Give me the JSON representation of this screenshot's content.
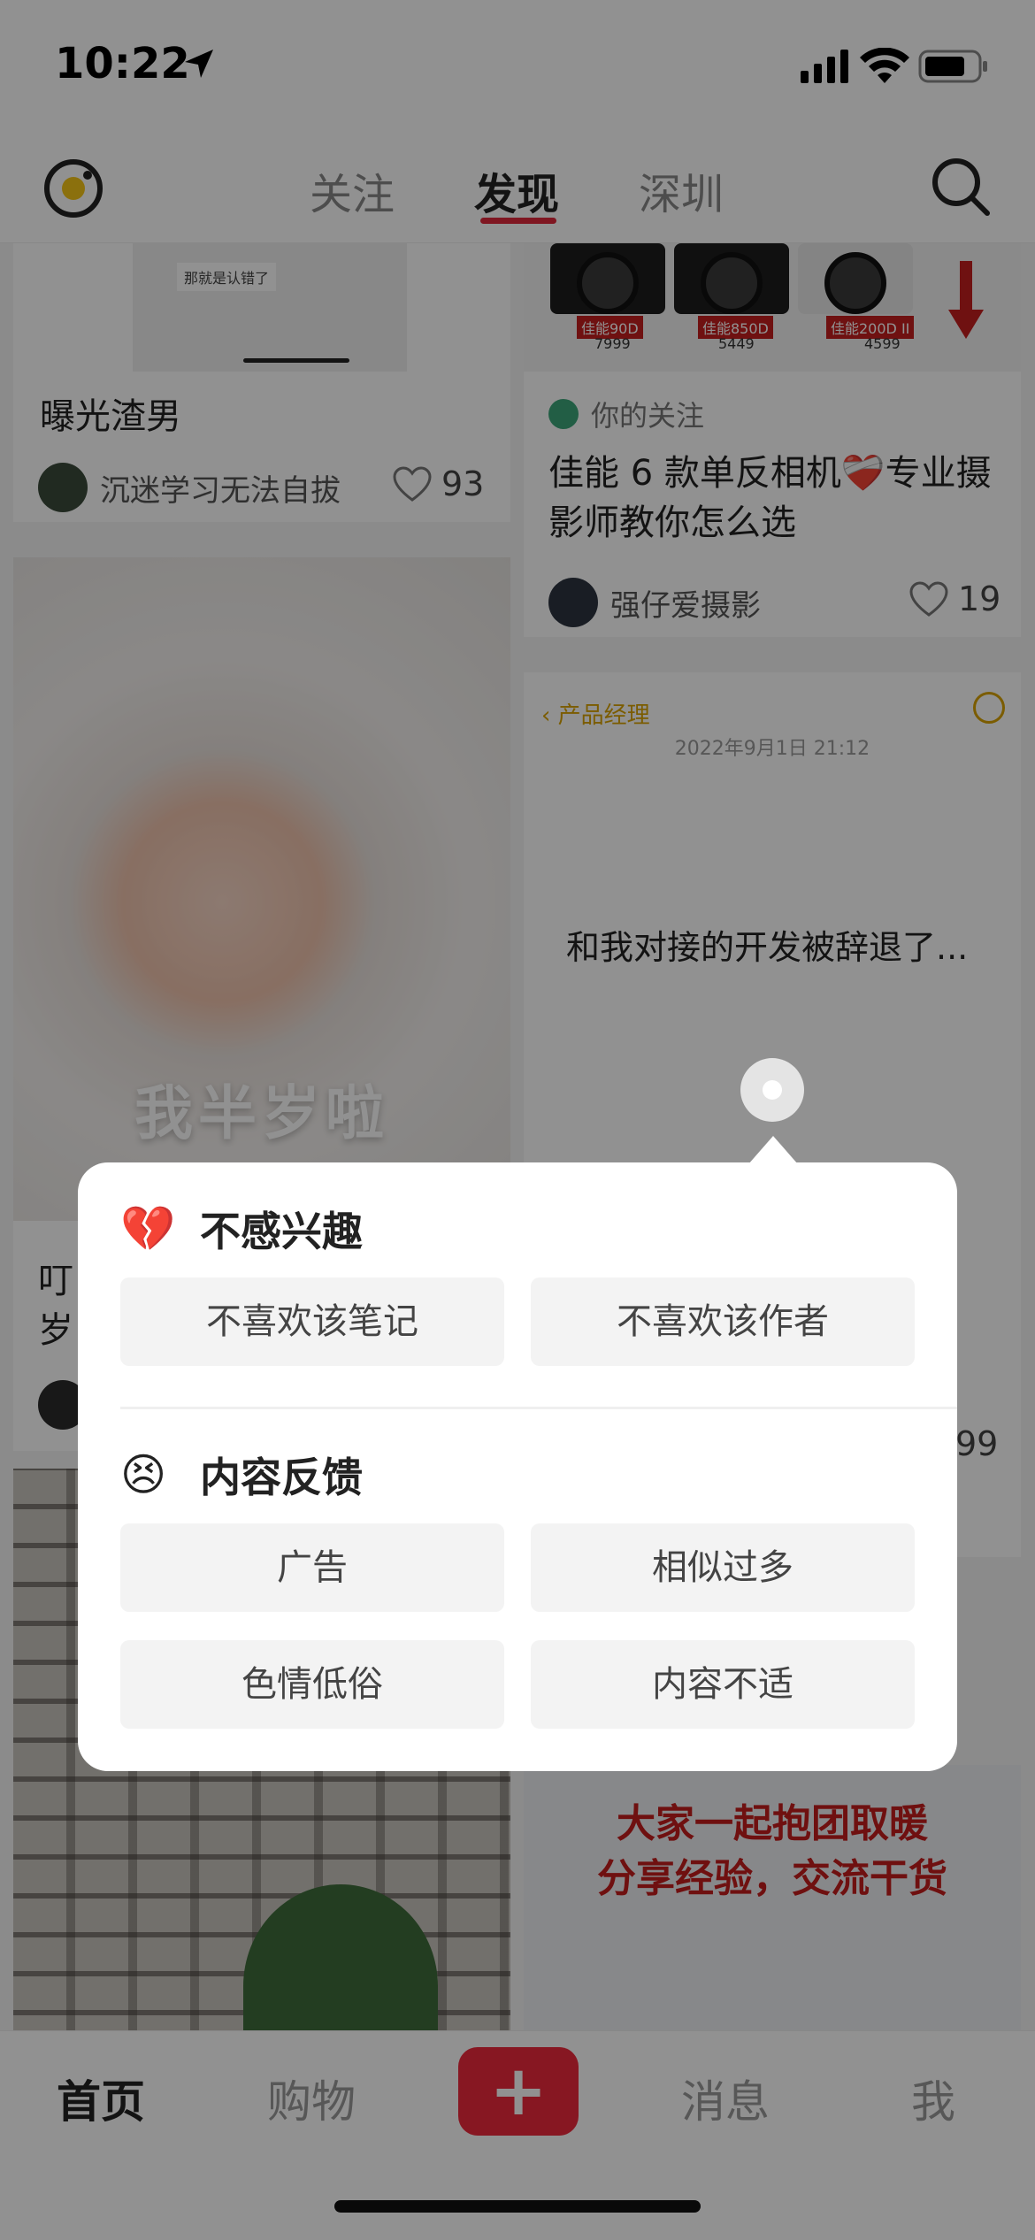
{
  "status_bar": {
    "time": "10:22"
  },
  "top_nav": {
    "tabs": [
      {
        "label": "关注",
        "active": false
      },
      {
        "label": "发现",
        "active": true
      },
      {
        "label": "深圳",
        "active": false
      }
    ],
    "accent_color": "#e0283a"
  },
  "feed": {
    "card_left_top": {
      "chat_bubble": "那就是认错了",
      "title": "曝光渣男",
      "author": "沉迷学习无法自拔",
      "likes": "93"
    },
    "card_right_top": {
      "cameras": [
        {
          "name": "佳能90D",
          "price": "7999"
        },
        {
          "name": "佳能850D",
          "price": "5449"
        },
        {
          "name": "佳能200D II",
          "price": "4599"
        }
      ],
      "following_tag": "你的关注",
      "title": "佳能 6 款单反相机❤️‍🩹专业摄影师教你怎么选",
      "author": "强仔爱摄影",
      "likes": "19"
    },
    "card_baby": {
      "caption": "我半岁啦",
      "title_partial_line1": "叮",
      "title_partial_line2": "岁"
    },
    "card_chat": {
      "header": "产品经理",
      "date": "2022年9月1日 21:12",
      "message": "和我对接的开发被辞退了...",
      "likes_partial": "99"
    },
    "card_poster": {
      "line1": "大家一起抱团取暖",
      "line2": "分享经验，交流干货"
    }
  },
  "popover": {
    "sections": [
      {
        "emoji": "💔",
        "title": "不感兴趣",
        "options": [
          "不喜欢该笔记",
          "不喜欢该作者"
        ]
      },
      {
        "emoji": "😣",
        "title": "内容反馈",
        "options": [
          "广告",
          "相似过多",
          "色情低俗",
          "内容不适"
        ]
      }
    ]
  },
  "tab_bar": {
    "home": "首页",
    "shop": "购物",
    "plus": "+",
    "messages": "消息",
    "me": "我",
    "plus_color": "#ee2a3d"
  }
}
